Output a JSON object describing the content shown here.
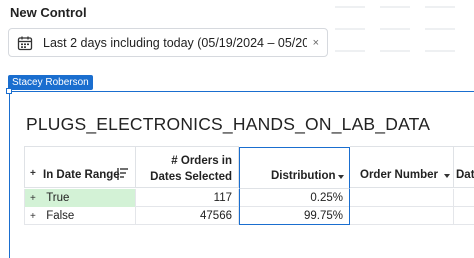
{
  "control": {
    "title": "New Control",
    "filter_text": "Last 2 days including today (05/19/2024 – 05/20...",
    "clear_icon": "×"
  },
  "user_tag": "Stacey Roberson",
  "table": {
    "title": "PLUGS_ELECTRONICS_HANDS_ON_LAB_DATA",
    "columns": {
      "in_date_range": "In Date Range",
      "orders_line1": "# Orders in",
      "orders_line2": "Dates Selected",
      "distribution": "Distribution",
      "order_number": "Order Number",
      "date_partial": "Dat"
    },
    "rows": [
      {
        "label": "True",
        "orders": "117",
        "distribution": "0.25%",
        "highlight_color": "#d3f2d6"
      },
      {
        "label": "False",
        "orders": "47566",
        "distribution": "99.75%"
      }
    ]
  },
  "colors": {
    "accent": "#1a6ecf",
    "true_highlight": "#d3f2d6"
  }
}
